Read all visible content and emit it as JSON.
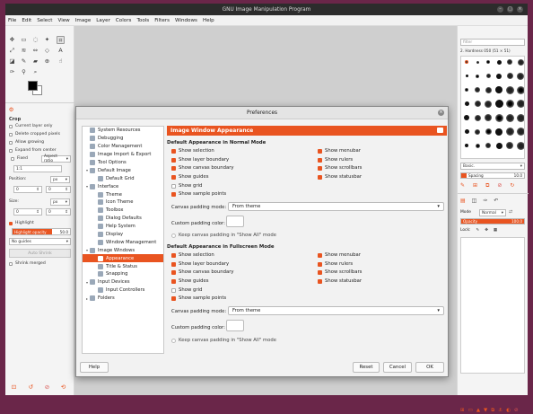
{
  "window": {
    "title": "GNU Image Manipulation Program"
  },
  "menu": [
    "File",
    "Edit",
    "Select",
    "View",
    "Image",
    "Layer",
    "Colors",
    "Tools",
    "Filters",
    "Windows",
    "Help"
  ],
  "tool_options": {
    "title": "Crop",
    "current_layer_only": "Current layer only",
    "delete_cropped": "Delete cropped pixels",
    "allow_growing": "Allow growing",
    "expand_center": "Expand from center",
    "fixed_label": "Fixed",
    "fixed_value": "Aspect ratio",
    "ratio_value": "1:1",
    "position_label": "Position:",
    "position_unit": "px",
    "position_x": "0",
    "position_y": "0",
    "size_label": "Size:",
    "size_unit": "px",
    "size_w": "0",
    "size_h": "0",
    "highlight_label": "Highlight",
    "highlight_opacity_label": "Highlight opacity",
    "highlight_opacity_value": "50.0",
    "guides_value": "No guides",
    "auto_shrink": "Auto Shrink",
    "shrink_merged": "Shrink merged"
  },
  "right_dock": {
    "filter_placeholder": "filter",
    "brush_name": "2. Hardness 050 (51 × 51)",
    "brush_category": "Basic.",
    "spacing_label": "Spacing",
    "spacing_value": "10.0",
    "mode_label": "Mode",
    "mode_value": "Normal",
    "opacity_label": "Opacity",
    "opacity_value": "100.0",
    "lock_label": "Lock:"
  },
  "dialog": {
    "title": "Preferences",
    "tree": [
      {
        "label": "System Resources",
        "level": 0,
        "arrow": ""
      },
      {
        "label": "Debugging",
        "level": 0,
        "arrow": ""
      },
      {
        "label": "Color Management",
        "level": 0,
        "arrow": ""
      },
      {
        "label": "Image Import & Export",
        "level": 0,
        "arrow": ""
      },
      {
        "label": "Tool Options",
        "level": 0,
        "arrow": ""
      },
      {
        "label": "Default Image",
        "level": 0,
        "arrow": "▾"
      },
      {
        "label": "Default Grid",
        "level": 1,
        "arrow": ""
      },
      {
        "label": "Interface",
        "level": 0,
        "arrow": "▾"
      },
      {
        "label": "Theme",
        "level": 1,
        "arrow": ""
      },
      {
        "label": "Icon Theme",
        "level": 1,
        "arrow": ""
      },
      {
        "label": "Toolbox",
        "level": 1,
        "arrow": ""
      },
      {
        "label": "Dialog Defaults",
        "level": 1,
        "arrow": ""
      },
      {
        "label": "Help System",
        "level": 1,
        "arrow": ""
      },
      {
        "label": "Display",
        "level": 1,
        "arrow": ""
      },
      {
        "label": "Window Management",
        "level": 1,
        "arrow": ""
      },
      {
        "label": "Image Windows",
        "level": 0,
        "arrow": "▾"
      },
      {
        "label": "Appearance",
        "level": 1,
        "arrow": "",
        "selected": true
      },
      {
        "label": "Title & Status",
        "level": 1,
        "arrow": ""
      },
      {
        "label": "Snapping",
        "level": 1,
        "arrow": ""
      },
      {
        "label": "Input Devices",
        "level": 0,
        "arrow": "▾"
      },
      {
        "label": "Input Controllers",
        "level": 1,
        "arrow": ""
      },
      {
        "label": "Folders",
        "level": 0,
        "arrow": "▸"
      }
    ],
    "page_title": "Image Window Appearance",
    "normal": {
      "heading": "Default Appearance in Normal Mode",
      "show_selection": "Show selection",
      "show_layer_boundary": "Show layer boundary",
      "show_canvas_boundary": "Show canvas boundary",
      "show_guides": "Show guides",
      "show_grid": "Show grid",
      "show_sample_points": "Show sample points",
      "show_menubar": "Show menubar",
      "show_rulers": "Show rulers",
      "show_scrollbars": "Show scrollbars",
      "show_statusbar": "Show statusbar",
      "padding_mode_label": "Canvas padding mode:",
      "padding_mode_value": "From theme",
      "padding_color_label": "Custom padding color:",
      "keep_padding": "Keep canvas padding in \"Show All\" mode"
    },
    "fullscreen": {
      "heading": "Default Appearance in Fullscreen Mode",
      "show_selection": "Show selection",
      "show_layer_boundary": "Show layer boundary",
      "show_canvas_boundary": "Show canvas boundary",
      "show_guides": "Show guides",
      "show_grid": "Show grid",
      "show_sample_points": "Show sample points",
      "show_menubar": "Show menubar",
      "show_rulers": "Show rulers",
      "show_scrollbars": "Show scrollbars",
      "show_statusbar": "Show statusbar",
      "padding_mode_label": "Canvas padding mode:",
      "padding_mode_value": "From theme",
      "padding_color_label": "Custom padding color:",
      "keep_padding": "Keep canvas padding in \"Show All\" mode"
    },
    "buttons": {
      "help": "Help",
      "reset": "Reset",
      "cancel": "Cancel",
      "ok": "OK"
    }
  },
  "colors": {
    "accent": "#e95420",
    "titlebar": "#2c2c2c",
    "desktop": "#6a2649"
  }
}
